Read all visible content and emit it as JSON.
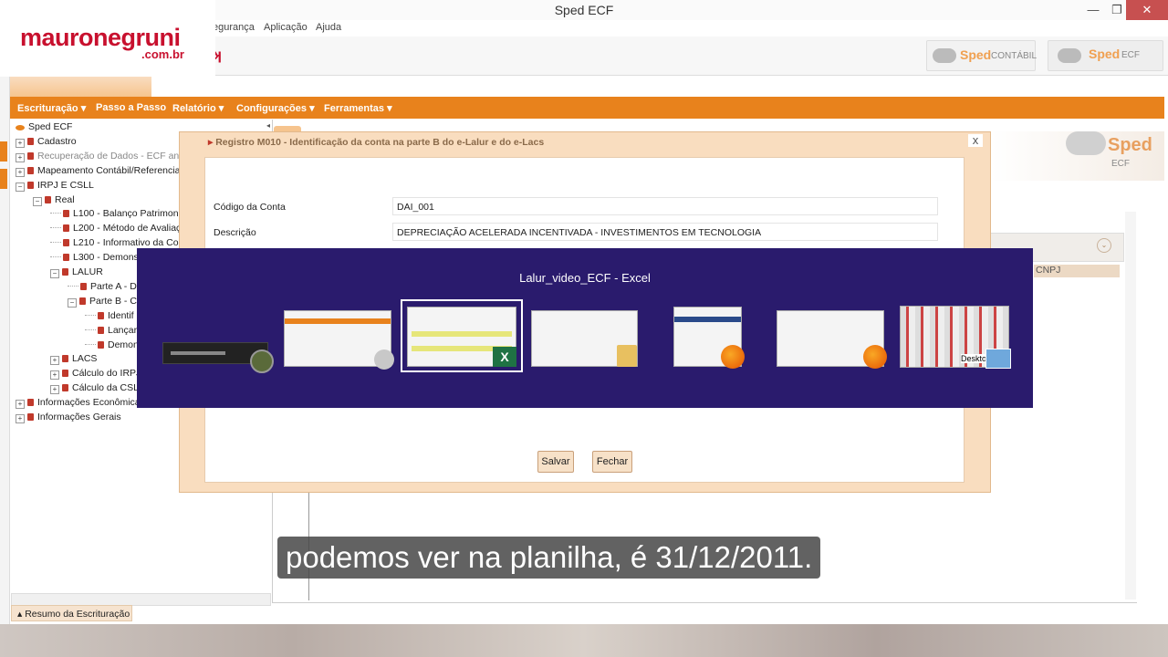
{
  "window": {
    "title": "Sped ECF",
    "minimize": "—",
    "restore": "❐",
    "close": "✕"
  },
  "logo": {
    "main": "mauronegruni",
    "sub": ".com.br"
  },
  "menubar": [
    "egurança",
    "Aplicação",
    "Ajuda"
  ],
  "toolbar": {
    "sped_contabil": {
      "word": "Sped",
      "sub": "CONTÁBIL"
    },
    "sped_ecf": {
      "word": "Sped",
      "sub": "ECF"
    }
  },
  "nav": [
    "Escrituração ▾",
    "Passo a Passo",
    "Relatório ▾",
    "Configurações ▾",
    "Ferramentas ▾"
  ],
  "tree": [
    {
      "label": "Sped ECF",
      "indent": 0,
      "exp": "",
      "icon": "sped"
    },
    {
      "label": "Cadastro",
      "indent": 0,
      "exp": "+",
      "icon": "bk"
    },
    {
      "label": "Recuperação de Dados - ECF ante",
      "indent": 0,
      "exp": "+",
      "icon": "bk",
      "dim": true
    },
    {
      "label": "Mapeamento Contábil/Referencia",
      "indent": 0,
      "exp": "+",
      "icon": "bk"
    },
    {
      "label": "IRPJ E CSLL",
      "indent": 0,
      "exp": "−",
      "icon": "bk"
    },
    {
      "label": "Real",
      "indent": 1,
      "exp": "−",
      "icon": "bk"
    },
    {
      "label": "L100 - Balanço Patrimonia",
      "indent": 2,
      "exp": "",
      "icon": "bk"
    },
    {
      "label": "L200 - Método de Avaliaç",
      "indent": 2,
      "exp": "",
      "icon": "bk"
    },
    {
      "label": "L210 - Informativo da Co",
      "indent": 2,
      "exp": "",
      "icon": "bk"
    },
    {
      "label": "L300 - Demons",
      "indent": 2,
      "exp": "",
      "icon": "bk"
    },
    {
      "label": "LALUR",
      "indent": 2,
      "exp": "−",
      "icon": "bk"
    },
    {
      "label": "Parte A - D",
      "indent": 3,
      "exp": "",
      "icon": "bk"
    },
    {
      "label": "Parte B - C",
      "indent": 3,
      "exp": "−",
      "icon": "bk"
    },
    {
      "label": "Identif",
      "indent": 4,
      "exp": "",
      "icon": "bk"
    },
    {
      "label": "Lançar",
      "indent": 4,
      "exp": "",
      "icon": "bk"
    },
    {
      "label": "Demon",
      "indent": 4,
      "exp": "",
      "icon": "bk"
    },
    {
      "label": "LACS",
      "indent": 2,
      "exp": "+",
      "icon": "bk"
    },
    {
      "label": "Cálculo do IRPJ",
      "indent": 2,
      "exp": "+",
      "icon": "bk"
    },
    {
      "label": "Cálculo da CSLL",
      "indent": 2,
      "exp": "+",
      "icon": "bk"
    },
    {
      "label": "Informações Econômica",
      "indent": 0,
      "exp": "+",
      "icon": "bk"
    },
    {
      "label": "Informações Gerais",
      "indent": 0,
      "exp": "+",
      "icon": "bk"
    }
  ],
  "resumo_tab": "▴ Resumo da Escrituração",
  "right": {
    "sped_word": "Sped",
    "sped_sub": "ECF",
    "cnpj": "CNPJ"
  },
  "dialog": {
    "title": "Registro M010 - Identificação da conta na parte B do e-Lalur e do e-Lacs",
    "close": "x",
    "codigo_label": "Código da Conta",
    "codigo_value": "DAI_001",
    "descricao_label": "Descrição",
    "descricao_value": "DEPRECIAÇÃO ACELERADA INCENTIVADA - INVESTIMENTOS EM TECNOLOGIA",
    "salvar": "Salvar",
    "fechar": "Fechar"
  },
  "switcher": {
    "title": "Lalur_video_ECF - Excel",
    "desktop_label": "Deskto"
  },
  "subtitle": "podemos ver na planilha, é 31/12/2011."
}
